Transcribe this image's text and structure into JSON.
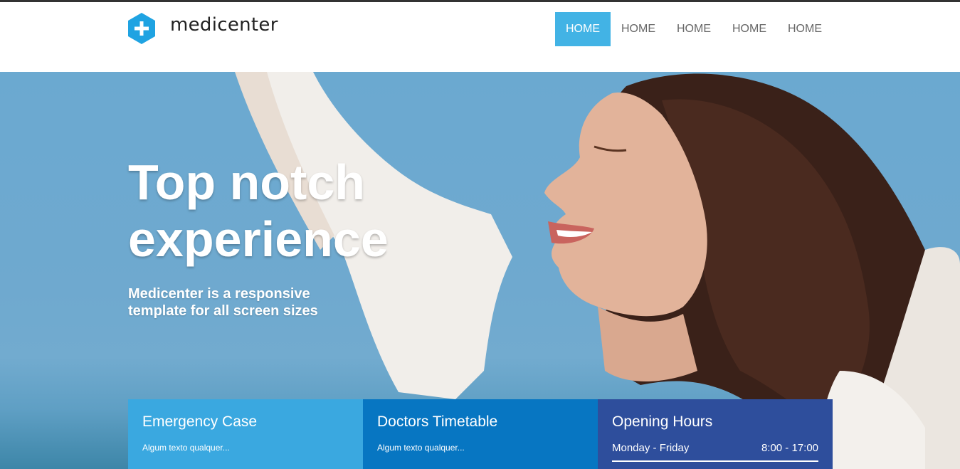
{
  "brand": {
    "name": "medicenter",
    "icon": "plus-hexagon-icon",
    "accent": "#42b3e5"
  },
  "nav": {
    "items": [
      {
        "label": "HOME",
        "active": true
      },
      {
        "label": "HOME",
        "active": false
      },
      {
        "label": "HOME",
        "active": false
      },
      {
        "label": "HOME",
        "active": false
      },
      {
        "label": "HOME",
        "active": false
      }
    ]
  },
  "hero": {
    "title_line1": "Top notch",
    "title_line2": "experience",
    "subtitle_line1": "Medicenter is a responsive",
    "subtitle_line2": "template for all screen sizes",
    "image": "smiling-woman-arms-raised-sky-photo"
  },
  "info_boxes": [
    {
      "title": "Emergency Case",
      "text": "Algum texto qualquer...",
      "color": "#3aa8e0"
    },
    {
      "title": "Doctors Timetable",
      "text": "Algum texto qualquer...",
      "color": "#0776c2"
    },
    {
      "title": "Opening Hours",
      "color": "#2e4e9c",
      "hours": {
        "day": "Monday - Friday",
        "time": "8:00 - 17:00"
      }
    }
  ]
}
